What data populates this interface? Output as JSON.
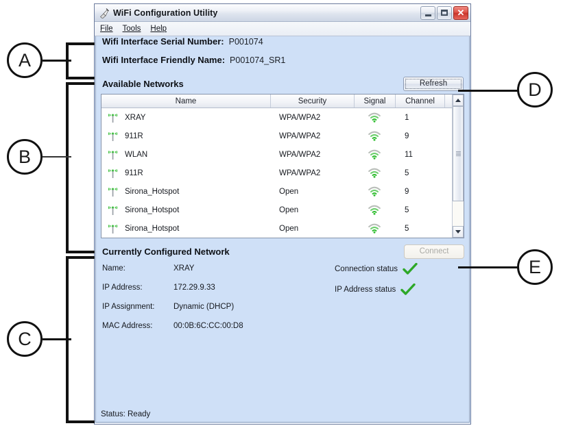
{
  "window": {
    "title": "WiFi Configuration Utility",
    "icon": "wifi-utility-icon",
    "buttons": {
      "minimize": "minimize-button",
      "maximize": "maximize-button",
      "close": "close-button",
      "close_glyph": "✕"
    }
  },
  "menubar": {
    "items": [
      {
        "label": "File"
      },
      {
        "label": "Tools"
      },
      {
        "label": "Help"
      }
    ]
  },
  "interface_info": {
    "serial_label": "Wifi Interface Serial Number:",
    "serial_value": "P001074",
    "friendly_label": "Wifi Interface Friendly Name:",
    "friendly_value": "P001074_SR1"
  },
  "available_networks": {
    "title": "Available Networks",
    "refresh_label": "Refresh",
    "columns": [
      "Name",
      "Security",
      "Signal",
      "Channel"
    ],
    "rows": [
      {
        "name": "XRAY",
        "security": "WPA/WPA2",
        "signal": "wifi-signal-icon",
        "channel": "1"
      },
      {
        "name": "911R",
        "security": "WPA/WPA2",
        "signal": "wifi-signal-icon",
        "channel": "9"
      },
      {
        "name": "WLAN",
        "security": "WPA/WPA2",
        "signal": "wifi-signal-icon",
        "channel": "11"
      },
      {
        "name": "911R",
        "security": "WPA/WPA2",
        "signal": "wifi-signal-icon",
        "channel": "5"
      },
      {
        "name": "Sirona_Hotspot",
        "security": "Open",
        "signal": "wifi-signal-icon",
        "channel": "9"
      },
      {
        "name": "Sirona_Hotspot",
        "security": "Open",
        "signal": "wifi-signal-icon",
        "channel": "5"
      },
      {
        "name": "Sirona_Hotspot",
        "security": "Open",
        "signal": "wifi-signal-icon",
        "channel": "5"
      }
    ]
  },
  "configured_network": {
    "title": "Currently Configured Network",
    "connect_label": "Connect",
    "connect_enabled": false,
    "fields": [
      {
        "label": "Name:",
        "value": "XRAY"
      },
      {
        "label": "IP Address:",
        "value": "172.29.9.33"
      },
      {
        "label": "IP Assignment:",
        "value": "Dynamic (DHCP)"
      },
      {
        "label": "MAC Address:",
        "value": "00:0B:6C:CC:00:D8"
      }
    ],
    "statuses": [
      {
        "label": "Connection status",
        "ok": true
      },
      {
        "label": "IP Address status",
        "ok": true
      }
    ]
  },
  "statusbar": {
    "text": "Status: Ready"
  },
  "callouts": [
    {
      "id": "A",
      "label": "A"
    },
    {
      "id": "B",
      "label": "B"
    },
    {
      "id": "C",
      "label": "C"
    },
    {
      "id": "D",
      "label": "D"
    },
    {
      "id": "E",
      "label": "E"
    }
  ],
  "colors": {
    "panel_blue": "#cfe0f7",
    "signal_green": "#3cbf3c",
    "check_green": "#2ea828",
    "close_red": "#c8342a"
  }
}
